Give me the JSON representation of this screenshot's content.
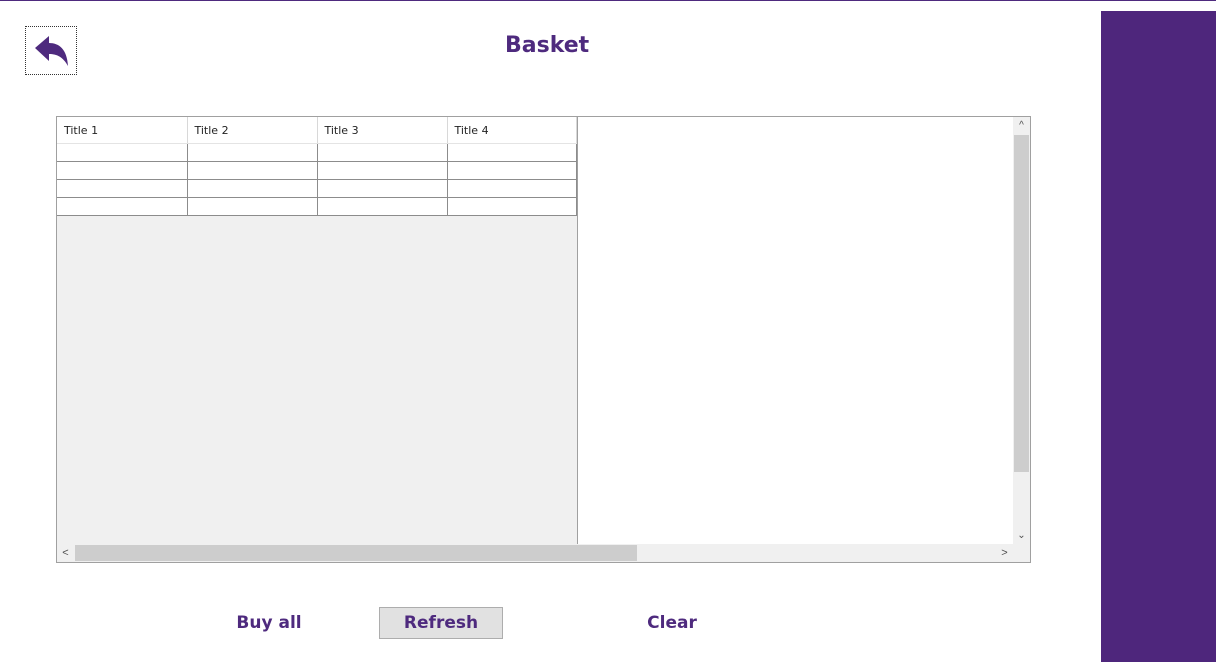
{
  "header": {
    "title": "Basket",
    "back_icon": "reply-arrow-icon"
  },
  "grid": {
    "columns": [
      "Title 1",
      "Title 2",
      "Title 3",
      "Title 4"
    ],
    "rows": [
      [
        "",
        "",
        "",
        ""
      ],
      [
        "",
        "",
        "",
        ""
      ],
      [
        "",
        "",
        "",
        ""
      ],
      [
        "",
        "",
        "",
        ""
      ]
    ]
  },
  "actions": {
    "buy_all": "Buy all",
    "refresh": "Refresh",
    "clear": "Clear"
  },
  "colors": {
    "accent": "#4e267c",
    "text": "#4e2a7e",
    "grid_background": "#f0f0f0"
  }
}
